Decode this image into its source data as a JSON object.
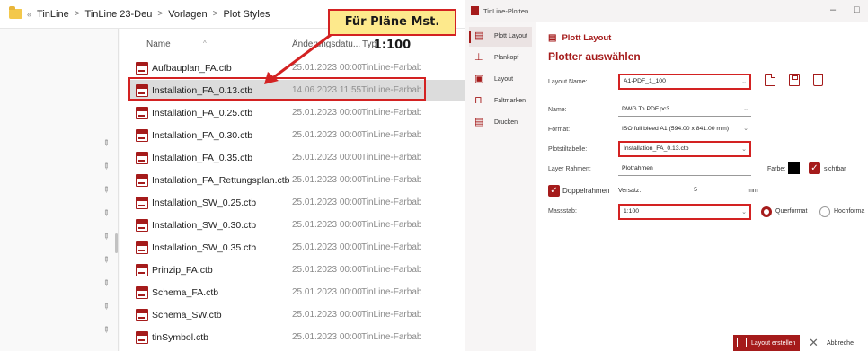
{
  "explorer": {
    "breadcrumb": [
      "TinLine",
      "TinLine 23-Deu",
      "Vorlagen",
      "Plot Styles"
    ],
    "columns": {
      "name": "Name",
      "modified": "Änderungsdatu...",
      "type": "Typ"
    },
    "files": [
      {
        "name": "Aufbauplan_FA.ctb",
        "date": "25.01.2023 00:00",
        "type": "TinLine-Farbab"
      },
      {
        "name": "Installation_FA_0.13.ctb",
        "date": "14.06.2023 11:55",
        "type": "TinLine-Farbab",
        "selected": true
      },
      {
        "name": "Installation_FA_0.25.ctb",
        "date": "25.01.2023 00:00",
        "type": "TinLine-Farbab"
      },
      {
        "name": "Installation_FA_0.30.ctb",
        "date": "25.01.2023 00:00",
        "type": "TinLine-Farbab"
      },
      {
        "name": "Installation_FA_0.35.ctb",
        "date": "25.01.2023 00:00",
        "type": "TinLine-Farbab"
      },
      {
        "name": "Installation_FA_Rettungsplan.ctb",
        "date": "25.01.2023 00:00",
        "type": "TinLine-Farbab"
      },
      {
        "name": "Installation_SW_0.25.ctb",
        "date": "25.01.2023 00:00",
        "type": "TinLine-Farbab"
      },
      {
        "name": "Installation_SW_0.30.ctb",
        "date": "25.01.2023 00:00",
        "type": "TinLine-Farbab"
      },
      {
        "name": "Installation_SW_0.35.ctb",
        "date": "25.01.2023 00:00",
        "type": "TinLine-Farbab"
      },
      {
        "name": "Prinzip_FA.ctb",
        "date": "25.01.2023 00:00",
        "type": "TinLine-Farbab"
      },
      {
        "name": "Schema_FA.ctb",
        "date": "25.01.2023 00:00",
        "type": "TinLine-Farbab"
      },
      {
        "name": "Schema_SW.ctb",
        "date": "25.01.2023 00:00",
        "type": "TinLine-Farbab"
      },
      {
        "name": "tinSymbol.ctb",
        "date": "25.01.2023 00:00",
        "type": "TinLine-Farbab"
      }
    ]
  },
  "callout": {
    "text": "Für Pläne Mst. 1:100"
  },
  "dialog": {
    "title": "TinLine-Plotten",
    "window_controls": {
      "minimize": "–",
      "maximize": "□"
    },
    "nav": [
      {
        "label": "Plott Layout",
        "active": true
      },
      {
        "label": "Plankopf"
      },
      {
        "label": "Layout"
      },
      {
        "label": "Faltmarken"
      },
      {
        "label": "Drucken"
      }
    ],
    "header": "Plott Layout",
    "section": "Plotter auswählen",
    "fields": {
      "layout_name": {
        "label": "Layout Name:",
        "value": "A1-PDF_1_100"
      },
      "name": {
        "label": "Name:",
        "value": "DWG To PDF.pc3"
      },
      "format": {
        "label": "Format:",
        "value": "ISO full bleed A1 (594.00 x 841.00 mm)"
      },
      "plot_style": {
        "label": "Plotstiltabelle:",
        "value": "Installation_FA_0.13.ctb"
      },
      "layer_frame": {
        "label": "Layer Rahmen:",
        "value": "Plotrahmen",
        "color_label": "Farbe:",
        "visible_label": "sichtbar",
        "visible": true
      },
      "double_frame": {
        "label": "Doppelrahmen",
        "checked": true,
        "offset_label": "Versatz:",
        "offset_value": "5",
        "unit": "mm"
      },
      "scale": {
        "label": "Massstab:",
        "value": "1:100",
        "landscape": "Querformat",
        "portrait": "Hochforma",
        "orientation": "landscape"
      }
    },
    "buttons": {
      "create": "Layout erstellen",
      "cancel": "Abbreche"
    }
  }
}
